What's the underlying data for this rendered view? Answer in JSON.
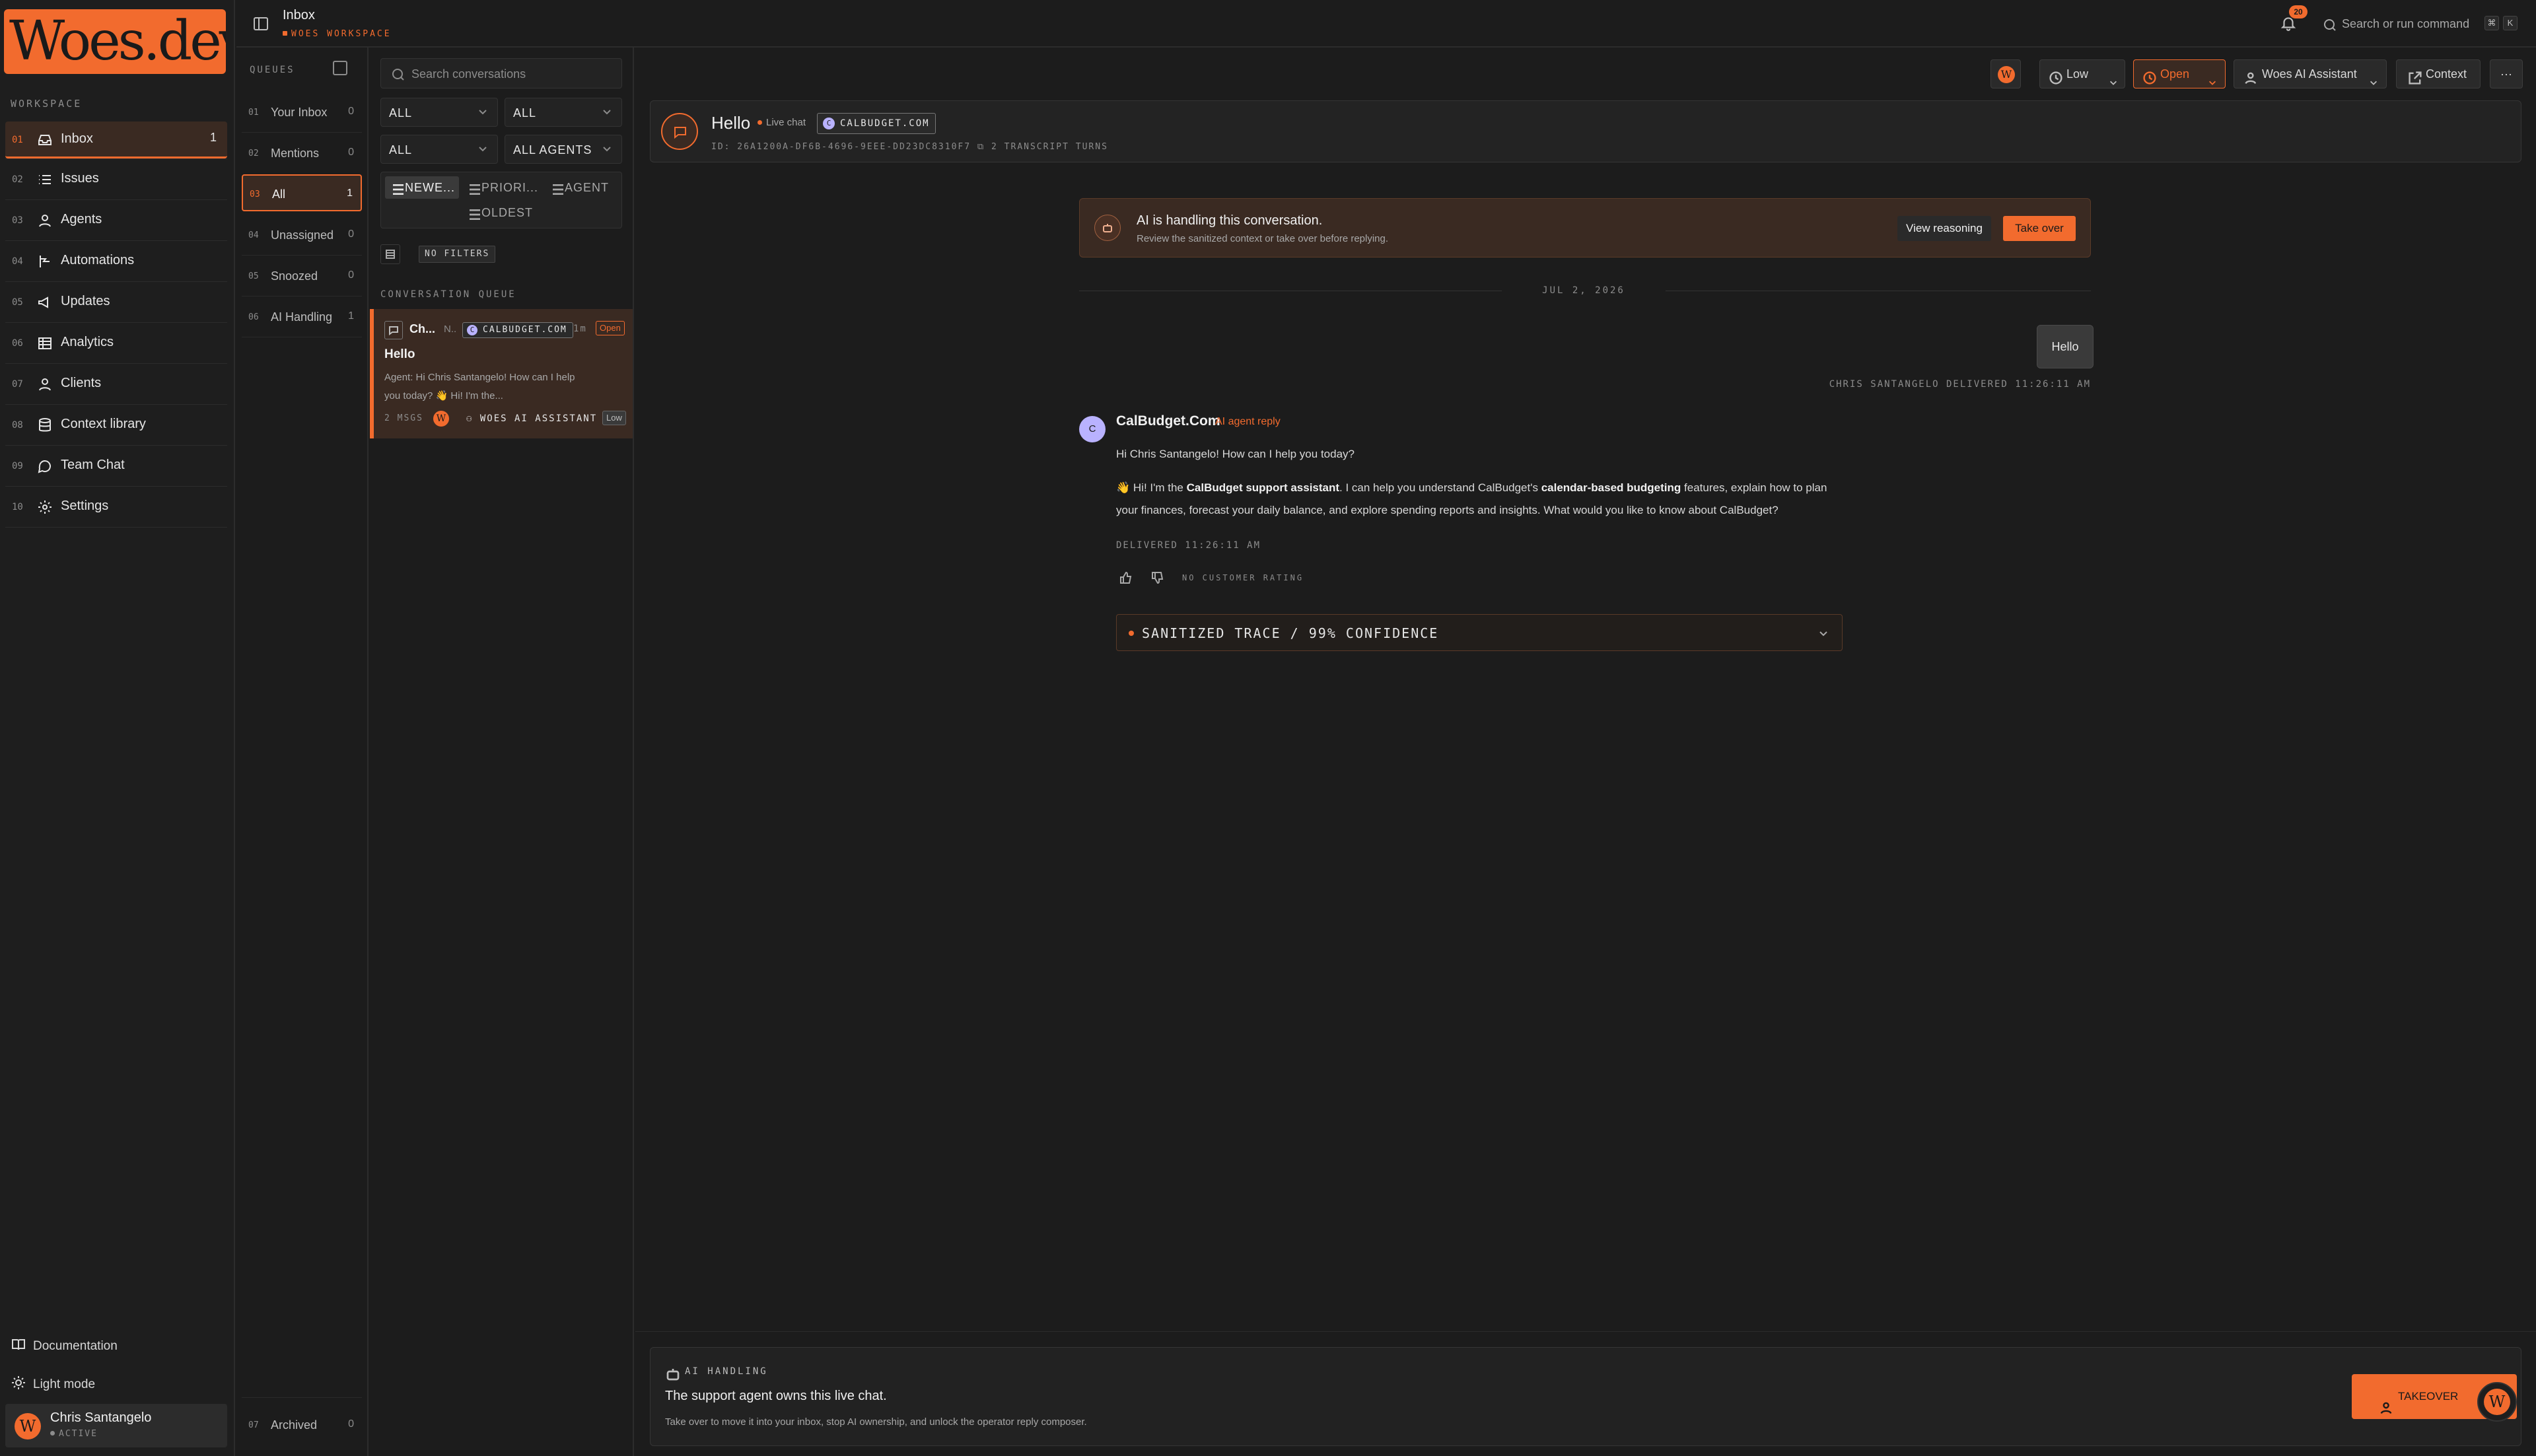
{
  "app": {
    "logo_text": "Woes.dev"
  },
  "colors": {
    "accent": "#f26b2e",
    "background": "#1c1c1c",
    "avatar_lavender": "#b9b2ff"
  },
  "sidebar": {
    "section_label": "WORKSPACE",
    "items": [
      {
        "num": "01",
        "label": "Inbox",
        "icon": "inbox-icon",
        "count": "1",
        "active": true
      },
      {
        "num": "02",
        "label": "Issues",
        "icon": "list-icon"
      },
      {
        "num": "03",
        "label": "Agents",
        "icon": "agent-icon"
      },
      {
        "num": "04",
        "label": "Automations",
        "icon": "automation-icon"
      },
      {
        "num": "05",
        "label": "Updates",
        "icon": "megaphone-icon"
      },
      {
        "num": "06",
        "label": "Analytics",
        "icon": "analytics-icon"
      },
      {
        "num": "07",
        "label": "Clients",
        "icon": "user-icon"
      },
      {
        "num": "08",
        "label": "Context library",
        "icon": "database-icon"
      },
      {
        "num": "09",
        "label": "Team Chat",
        "icon": "chat-icon"
      },
      {
        "num": "10",
        "label": "Settings",
        "icon": "gear-icon"
      }
    ],
    "documentation": "Documentation",
    "light_mode": "Light mode",
    "user": {
      "name": "Chris Santangelo",
      "status": "ACTIVE",
      "avatar_letter": "W"
    }
  },
  "topbar": {
    "title": "Inbox",
    "workspace": "WOES WORKSPACE",
    "notification_count": "20",
    "search_placeholder": "Search or run command",
    "shortcut_keys": [
      "⌘",
      "K"
    ]
  },
  "queues": {
    "title": "QUEUES",
    "items": [
      {
        "num": "01",
        "label": "Your Inbox",
        "count": "0"
      },
      {
        "num": "02",
        "label": "Mentions",
        "count": "0"
      },
      {
        "num": "03",
        "label": "All",
        "count": "1",
        "active": true
      },
      {
        "num": "04",
        "label": "Unassigned",
        "count": "0"
      },
      {
        "num": "05",
        "label": "Snoozed",
        "count": "0"
      },
      {
        "num": "06",
        "label": "AI Handling",
        "count": "1"
      }
    ],
    "archived": {
      "num": "07",
      "label": "Archived",
      "count": "0"
    }
  },
  "convlist": {
    "search_placeholder": "Search conversations",
    "filters": {
      "f1": "ALL",
      "f2": "ALL",
      "f3": "ALL",
      "f4": "ALL AGENTS"
    },
    "sort": {
      "newest": "NEWE...",
      "priority": "PRIORI...",
      "agent": "AGENT",
      "oldest": "OLDEST"
    },
    "no_filters": "NO FILTERS",
    "queue_label": "CONVERSATION QUEUE",
    "card": {
      "name": "Ch...",
      "name2": "N..",
      "domain": "CALBUDGET.COM",
      "domain_letter": "C",
      "time": "1m",
      "status": "Open",
      "subject": "Hello",
      "preview": "Agent: Hi Chris Santangelo! How can I help you today? 👋 Hi! I'm the...",
      "msgs": "2 MSGS",
      "assistant": "WOES AI ASSISTANT",
      "priority": "Low",
      "avatar_letter": "W"
    }
  },
  "conversation": {
    "toolbar": {
      "avatar_letter": "W",
      "priority": "Low",
      "status": "Open",
      "assignee": "Woes AI Assistant",
      "context": "Context",
      "more": "···"
    },
    "header": {
      "title": "Hello",
      "channel": "Live chat",
      "domain": "CALBUDGET.COM",
      "domain_letter": "C",
      "id_text": "ID: 26A1200A-DF6B-4696-9EEE-DD23DC8310F7",
      "turns": "2 TRANSCRIPT TURNS"
    },
    "ai_banner": {
      "title": "AI is handling this conversation.",
      "subtitle": "Review the sanitized context or take over before replying.",
      "view_reasoning": "View reasoning",
      "take_over": "Take over"
    },
    "date": "JUL 2, 2026",
    "user_message": {
      "text": "Hello",
      "meta": "CHRIS SANTANGELO DELIVERED 11:26:11 AM"
    },
    "agent_message": {
      "avatar_letter": "C",
      "name": "CalBudget.Com",
      "tag": "AI agent reply",
      "p1": "Hi Chris Santangelo! How can I help you today?",
      "p2_a": "👋 Hi! I'm the ",
      "p2_b": "CalBudget support assistant",
      "p2_c": ". I can help you understand CalBudget's ",
      "p2_d": "calendar-based budgeting",
      "p2_e": " features, explain how to plan your finances, forecast your daily balance, and explore spending reports and insights. What would you like to know about CalBudget?",
      "delivered": "DELIVERED 11:26:11 AM",
      "rating": "NO CUSTOMER RATING",
      "trace": "SANITIZED TRACE / 99% CONFIDENCE"
    },
    "composer": {
      "tag": "AI HANDLING",
      "title": "The support agent owns this live chat.",
      "subtitle": "Take over to move it into your inbox, stop AI ownership, and unlock the operator reply composer.",
      "takeover": "TAKEOVER",
      "fab_letter": "W"
    }
  }
}
